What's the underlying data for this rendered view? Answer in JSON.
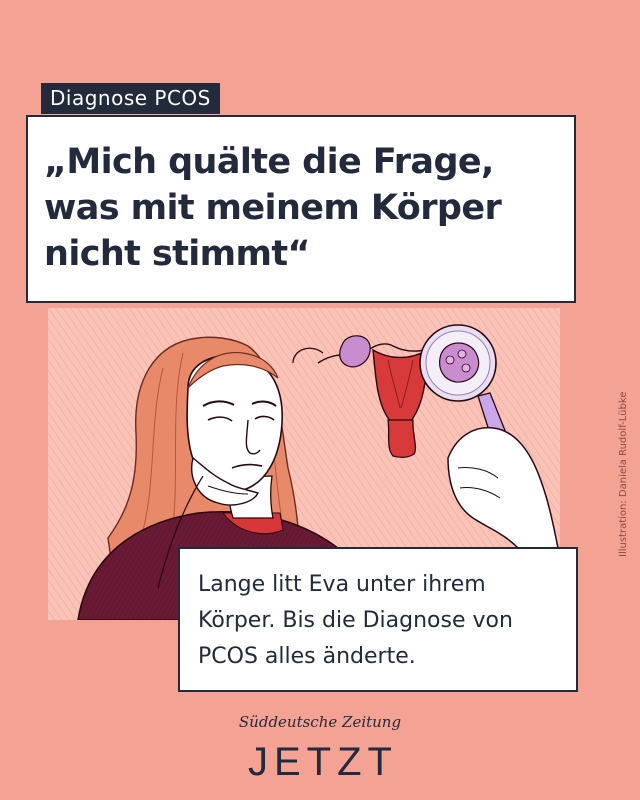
{
  "tag": "Diagnose PCOS",
  "headline": {
    "lines": [
      "„Mich quälte die Frage,",
      "was mit meinem Körper",
      "nicht stimmt“"
    ]
  },
  "credit": "Illustration: Daniela Rudolf-Lübke",
  "caption": {
    "lines": [
      "Lange litt Eva unter ihrem",
      "Körper. Bis die Diagnose von",
      "PCOS alles änderte."
    ]
  },
  "brand": {
    "publisher": "Süddeutsche Zeitung",
    "name": "JETZT"
  },
  "colors": {
    "background": "#f4a293",
    "ink": "#222a3c",
    "illustration_bg": "#f9c3b8",
    "uterus": "#d83a3a",
    "sweater": "#6a1a34",
    "hair": "#e88a6a"
  }
}
